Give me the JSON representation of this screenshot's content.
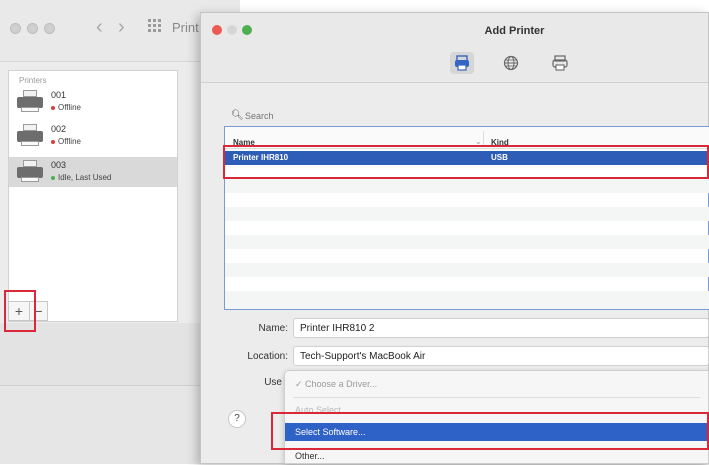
{
  "background_window": {
    "title": "Print",
    "list_heading": "Printers",
    "printers": [
      {
        "name": "001",
        "status": "Offline",
        "status_color": "#d64040"
      },
      {
        "name": "002",
        "status": "Offline",
        "status_color": "#d64040"
      },
      {
        "name": "003",
        "status": "Idle, Last Used",
        "status_color": "#4caf50",
        "selected": true
      }
    ],
    "add_button": "+",
    "remove_button": "−"
  },
  "dialog": {
    "title": "Add Printer",
    "toolbar": [
      "default-printer-icon",
      "ip-globe-icon",
      "windows-printer-icon"
    ],
    "search_placeholder": "Search",
    "table": {
      "columns": [
        "Name",
        "Kind"
      ],
      "rows": [
        {
          "name": "Printer IHR810",
          "kind": "USB",
          "selected": true
        }
      ]
    },
    "form": {
      "name_label": "Name:",
      "name_value": "Printer IHR810 2",
      "location_label": "Location:",
      "location_value": "Tech-Support's MacBook Air",
      "use_label": "Use"
    },
    "dropdown_menu": {
      "items": [
        "✓ Choose a Driver...",
        "Auto Select",
        "Select Software...",
        "Other..."
      ],
      "highlighted": "Select Software..."
    },
    "help_label": "?"
  },
  "colors": {
    "selection_blue": "#2d5db6",
    "menu_highlight": "#2f62c7",
    "annotation_red": "#d8283a",
    "close_red": "#ee5a52"
  }
}
